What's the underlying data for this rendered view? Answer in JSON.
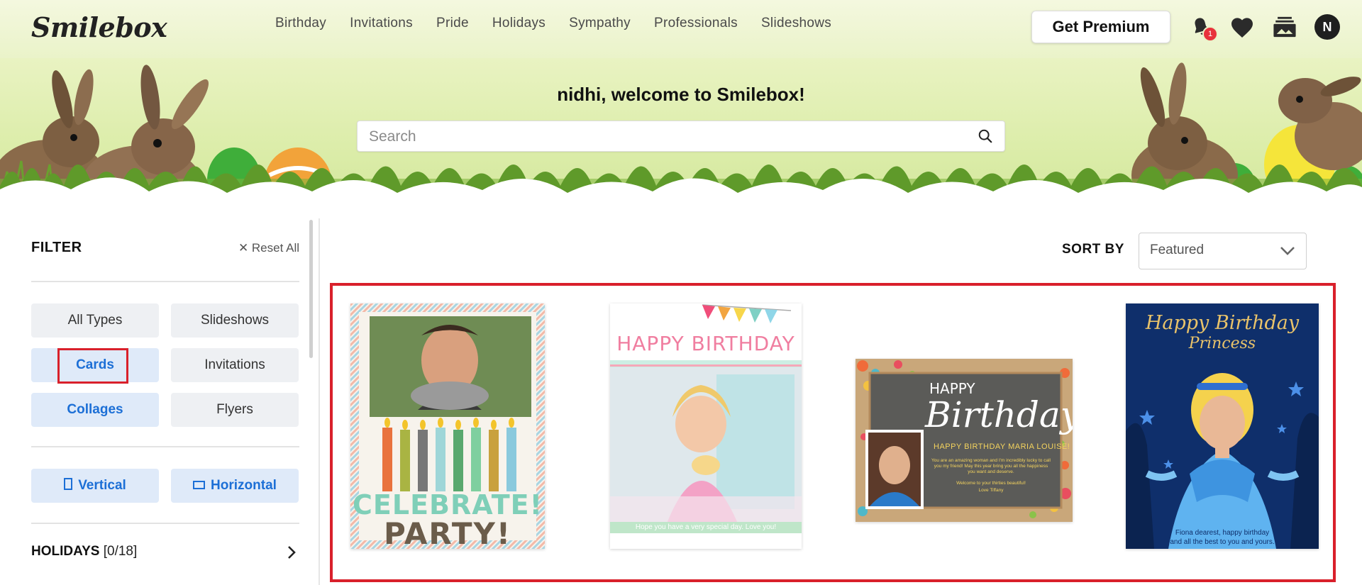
{
  "header": {
    "logo": "Smilebox",
    "nav": [
      "Birthday",
      "Invitations",
      "Pride",
      "Holidays",
      "Sympathy",
      "Professionals",
      "Slideshows"
    ],
    "premium_label": "Get Premium",
    "notification_count": "1",
    "avatar_initial": "N"
  },
  "hero": {
    "welcome": "nidhi, welcome to Smilebox!",
    "search_placeholder": "Search"
  },
  "filter": {
    "title": "FILTER",
    "reset_label": "Reset All",
    "types": [
      "All Types",
      "Slideshows",
      "Cards",
      "Invitations",
      "Collages",
      "Flyers"
    ],
    "active_types": [
      "Cards",
      "Collages"
    ],
    "orientation": [
      "Vertical",
      "Horizontal"
    ],
    "holidays_label": "HOLIDAYS",
    "holidays_count": "[0/18]"
  },
  "sort": {
    "label": "SORT BY",
    "selected": "Featured"
  },
  "cards": [
    {
      "top_text": "",
      "big_text_1": "CELEBRATE!",
      "big_text_2": "PARTY!"
    },
    {
      "top_text": "HAPPY BIRTHDAY",
      "caption": "Hope you have a very special day. Love you!"
    },
    {
      "title_1": "HAPPY",
      "title_2": "Birthday",
      "subtitle": "HAPPY BIRTHDAY MARIA LOUISE!",
      "body": "You are an amazing woman and I'm incredibly lucky to call you my friend! May this year bring you all the happiness you want and deserve.",
      "welcome": "Welcome to your thirties beautiful!",
      "sign": "Love Tiffany"
    },
    {
      "title_1": "Happy Birthday",
      "title_2": "Princess",
      "caption_1": "Fiona dearest, happy birthday",
      "caption_2": "and all the best to you and yours."
    }
  ],
  "colors": {
    "accent": "#1c6fd6",
    "highlight": "#d9202b",
    "badge": "#e8323c"
  }
}
